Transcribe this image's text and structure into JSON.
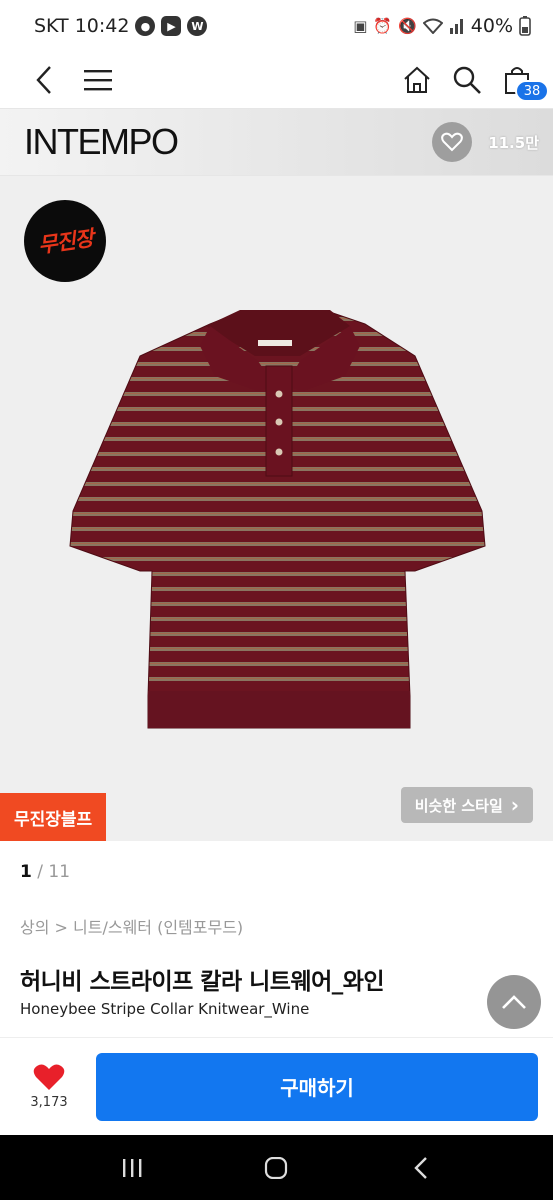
{
  "status_bar": {
    "carrier_time": "SKT 10:42",
    "battery": "40%",
    "app_icons": [
      "chat-icon",
      "youtube-icon",
      "w-icon"
    ],
    "w_label": "W"
  },
  "header": {
    "cart_count": "38"
  },
  "brand": {
    "name": "INTEMPO",
    "like_count": "11.5만"
  },
  "product": {
    "shop_logo_text": "무진장",
    "badge": "무진장블프",
    "similar_style": "비슷한 스타일",
    "similar_chevron": "›",
    "image_page_current": "1",
    "image_page_sep": " / ",
    "image_page_total": "11",
    "breadcrumb": "상의 > 니트/스웨터 (인템포무드)",
    "title_kr": "허니비 스트라이프 칼라 니트웨어_와인",
    "title_en": "Honeybee Stripe Collar Knitwear_Wine",
    "colors": {
      "wine": "#6b1420",
      "stripe": "#8a7560"
    }
  },
  "bottom_bar": {
    "wish_count": "3,173",
    "buy_label": "구매하기"
  },
  "colors": {
    "accent": "#1277f0",
    "badge_red": "#f04a22",
    "heart": "#e8202a"
  }
}
